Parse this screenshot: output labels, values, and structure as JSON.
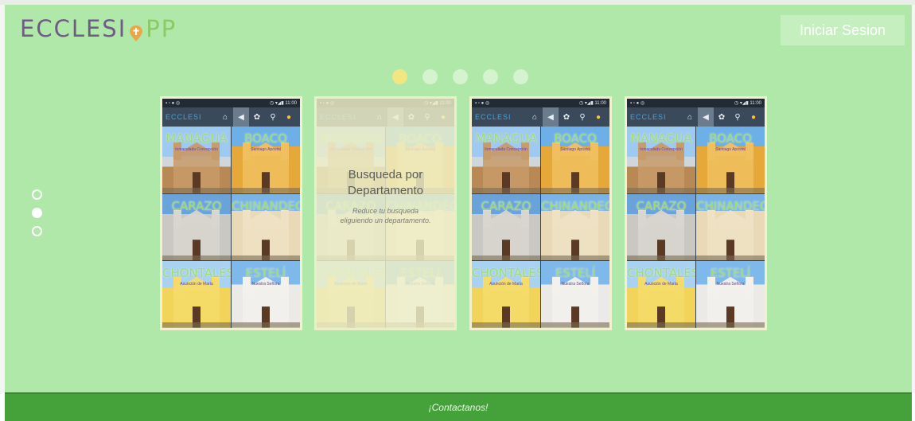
{
  "brand": {
    "logo_left": "ECCLESI",
    "logo_right": "PP",
    "accent_purple": "#6f5b86",
    "accent_green": "#8ec866"
  },
  "header": {
    "login_label": "Iniciar Sesion"
  },
  "carousel": {
    "dot_count": 5,
    "active_dot": 0
  },
  "side_nav": {
    "count": 3,
    "active": 1
  },
  "phone": {
    "time": "11:00",
    "app_brand": "ECCLESI",
    "icons": [
      "home-icon",
      "back-icon",
      "settings-icon",
      "search-icon",
      "location-pin-icon"
    ],
    "tiles": [
      {
        "name": "MANAGUA",
        "sub": "Inmaculada Concepción"
      },
      {
        "name": "BOACO",
        "sub": "Santiago Apóstol"
      },
      {
        "name": "CARAZO",
        "sub": ""
      },
      {
        "name": "CHINANDEGA",
        "sub": ""
      },
      {
        "name": "CHONTALES",
        "sub": "Asunción de María"
      },
      {
        "name": "ESTELÍ",
        "sub": "Nuestra Señora"
      }
    ]
  },
  "feature_card": {
    "title": "Busqueda por Departamento",
    "description": "Reduce tu busqueda eligiendo un departamento."
  },
  "footer": {
    "contact_label": "¡Contactanos!"
  }
}
